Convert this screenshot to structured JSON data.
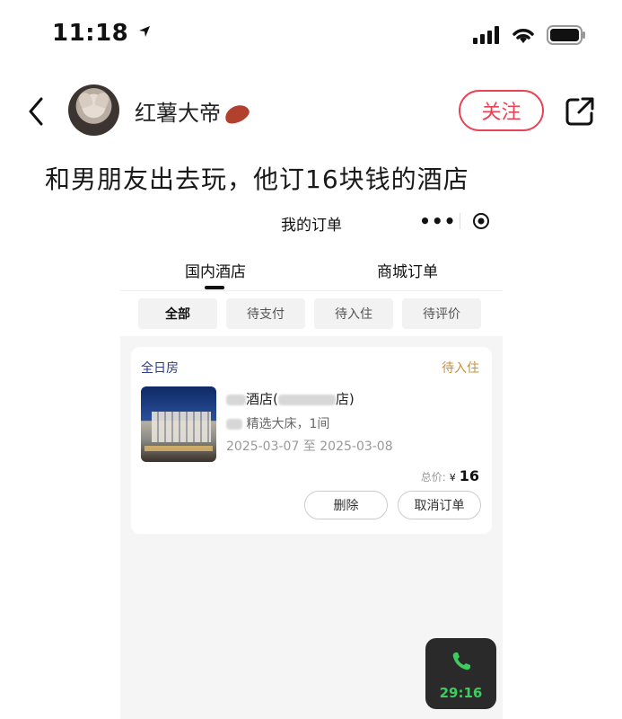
{
  "status_bar": {
    "time": "11:18"
  },
  "post": {
    "username": "红薯大帝",
    "follow_label": "关注",
    "title": "和男朋友出去玩，他订16块钱的酒店"
  },
  "embedded_app": {
    "title": "我的订单",
    "capsule_more": "•••",
    "top_tabs": [
      "国内酒店",
      "商城订单"
    ],
    "filters": [
      "全部",
      "待支付",
      "待入住",
      "待评价"
    ],
    "order": {
      "room_type": "全日房",
      "status": "待入住",
      "hotel_name": "酒店(",
      "hotel_name_end": "店)",
      "room_desc": "精选大床，1间",
      "date_range": "2025-03-07 至 2025-03-08",
      "total_label": "总价:",
      "currency": "¥",
      "total_amount": "16",
      "delete_label": "删除",
      "cancel_label": "取消订单"
    }
  },
  "call": {
    "duration": "29:16"
  },
  "colors": {
    "accent_red": "#e84356",
    "status_gold": "#c7913a",
    "call_green": "#3dcc5d"
  }
}
